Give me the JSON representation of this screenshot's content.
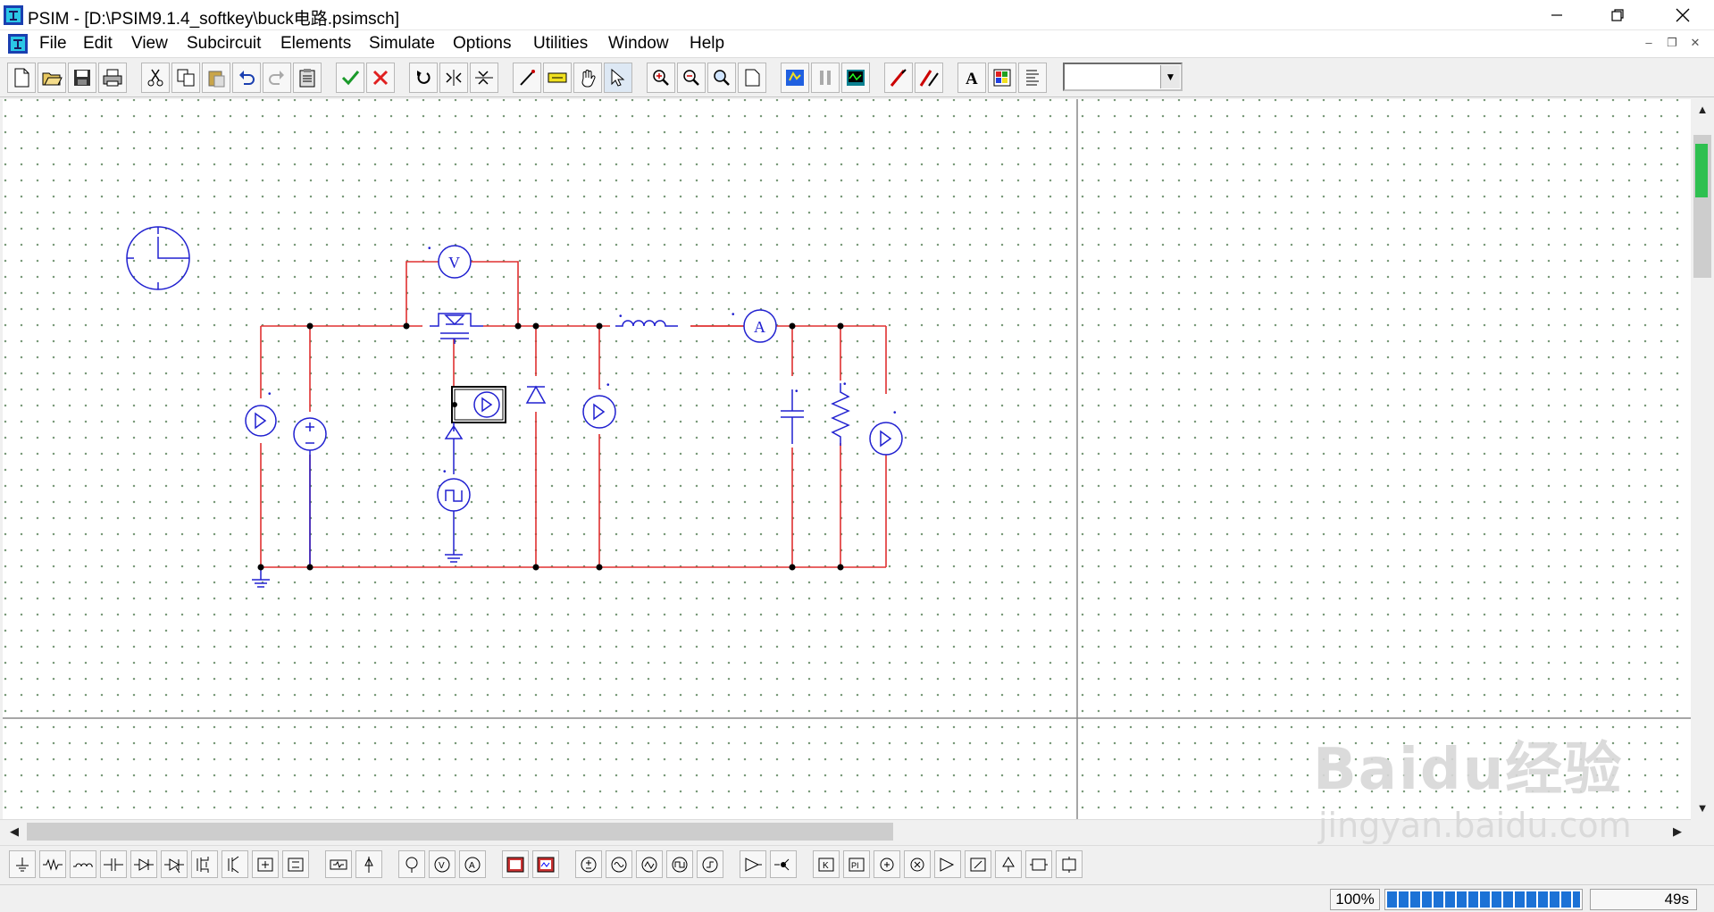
{
  "window": {
    "title": "PSIM - [D:\\PSIM9.1.4_softkey\\buck电路.psimsch]",
    "app_icon": "psim-app-icon"
  },
  "menu": {
    "items": [
      "File",
      "Edit",
      "View",
      "Subcircuit",
      "Elements",
      "Simulate",
      "Options",
      "Utilities",
      "Window",
      "Help"
    ]
  },
  "toolbar": {
    "icons": [
      "new-file-icon",
      "open-folder-icon",
      "save-icon",
      "print-icon",
      "cut-icon",
      "copy-icon",
      "paste-icon",
      "undo-icon",
      "redo-icon",
      "clipboard-icon",
      "check-icon",
      "delete-icon",
      "rotate-icon",
      "flip-lr-icon",
      "flip-tb-icon",
      "wire-icon",
      "label-icon",
      "pan-hand-icon",
      "select-arrow-icon",
      "zoom-in-icon",
      "zoom-out-icon",
      "zoom-fit-icon",
      "page-icon",
      "run-simulation-icon",
      "pause-icon",
      "simview-icon",
      "probe-red-icon",
      "probe-multi-icon",
      "text-icon",
      "color-icon",
      "parameter-icon"
    ],
    "combo_value": ""
  },
  "status": {
    "zoom": "100%",
    "progress": 1.0,
    "time": "49s"
  },
  "watermark": {
    "brand": "Baidu经验",
    "url": "jingyan.baidu.com"
  },
  "colors": {
    "wire": "#e03030",
    "component": "#2020d0",
    "grid_dot": "#6a8a6a"
  }
}
